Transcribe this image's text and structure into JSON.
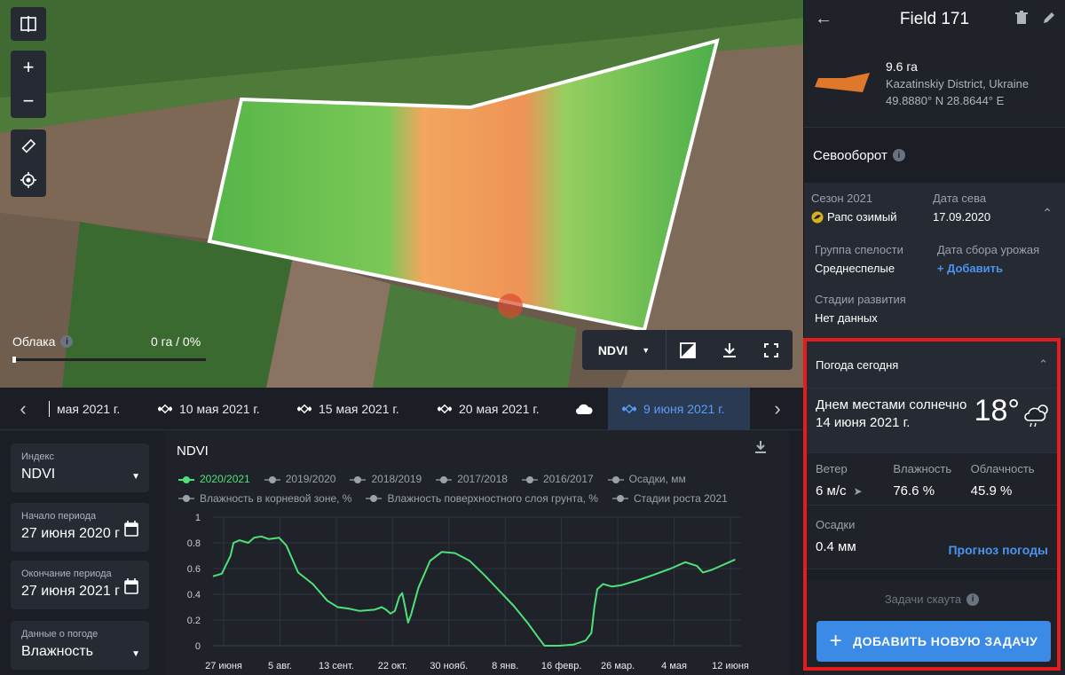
{
  "map": {
    "clouds_label": "Облака",
    "clouds_value": "0 га / 0%",
    "index_label": "NDVI",
    "clouds_slider_fraction": 0.0
  },
  "dates": {
    "items": [
      "мая 2021 г.",
      "10 мая 2021 г.",
      "15 мая 2021 г.",
      "20 мая 2021 г.",
      "",
      "9 июня 2021 г."
    ],
    "active_index": 5
  },
  "filters": {
    "index": {
      "label": "Индекс",
      "value": "NDVI"
    },
    "start": {
      "label": "Начало периода",
      "value": "27 июня 2020 г"
    },
    "end": {
      "label": "Окончание периода",
      "value": "27 июня 2021 г"
    },
    "weather": {
      "label": "Данные о погоде",
      "value": "Влажность"
    }
  },
  "chart_panel": {
    "title": "NDVI",
    "legend": [
      {
        "label": "2020/2021",
        "active": true
      },
      {
        "label": "2019/2020",
        "active": false
      },
      {
        "label": "2018/2019",
        "active": false
      },
      {
        "label": "2017/2018",
        "active": false
      },
      {
        "label": "2016/2017",
        "active": false
      },
      {
        "label": "Осадки, мм",
        "active": false
      },
      {
        "label": "Влажность в корневой зоне, %",
        "active": false
      },
      {
        "label": "Влажность поверхностного слоя грунта, %",
        "active": false
      },
      {
        "label": "Стадии роста 2021",
        "active": false
      }
    ]
  },
  "chart_data": {
    "type": "line",
    "title": "NDVI",
    "xlabel": "",
    "ylabel": "",
    "ylim": [
      0,
      1
    ],
    "yticks": [
      "1",
      "0.8",
      "0.6",
      "0.4",
      "0.2",
      "0"
    ],
    "xticks": [
      "27 июня",
      "5 авг.",
      "13 сент.",
      "22 окт.",
      "30 нояб.",
      "8 янв.",
      "16 февр.",
      "26 мар.",
      "4 мая",
      "12 июня"
    ],
    "grid": true,
    "series": [
      {
        "name": "2020/2021",
        "color": "#4fe07a",
        "points": [
          [
            0,
            0.54
          ],
          [
            6,
            0.56
          ],
          [
            12,
            0.7
          ],
          [
            14,
            0.8
          ],
          [
            18,
            0.82
          ],
          [
            24,
            0.8
          ],
          [
            28,
            0.84
          ],
          [
            33,
            0.85
          ],
          [
            38,
            0.83
          ],
          [
            45,
            0.84
          ],
          [
            50,
            0.78
          ],
          [
            58,
            0.57
          ],
          [
            68,
            0.48
          ],
          [
            78,
            0.35
          ],
          [
            85,
            0.3
          ],
          [
            92,
            0.29
          ],
          [
            100,
            0.27
          ],
          [
            110,
            0.28
          ],
          [
            115,
            0.3
          ],
          [
            118,
            0.28
          ],
          [
            121,
            0.25
          ],
          [
            124,
            0.27
          ],
          [
            127,
            0.38
          ],
          [
            129,
            0.41
          ],
          [
            131,
            0.3
          ],
          [
            133,
            0.18
          ],
          [
            135,
            0.24
          ],
          [
            140,
            0.45
          ],
          [
            148,
            0.66
          ],
          [
            156,
            0.73
          ],
          [
            165,
            0.72
          ],
          [
            175,
            0.66
          ],
          [
            185,
            0.55
          ],
          [
            195,
            0.43
          ],
          [
            205,
            0.31
          ],
          [
            215,
            0.17
          ],
          [
            222,
            0.06
          ],
          [
            226,
            0.0
          ],
          [
            236,
            0.0
          ],
          [
            246,
            0.01
          ],
          [
            254,
            0.04
          ],
          [
            258,
            0.1
          ],
          [
            260,
            0.3
          ],
          [
            262,
            0.44
          ],
          [
            266,
            0.48
          ],
          [
            272,
            0.46
          ],
          [
            278,
            0.47
          ],
          [
            290,
            0.51
          ],
          [
            300,
            0.55
          ],
          [
            312,
            0.6
          ],
          [
            322,
            0.65
          ],
          [
            330,
            0.62
          ],
          [
            334,
            0.57
          ],
          [
            340,
            0.59
          ],
          [
            350,
            0.64
          ],
          [
            356,
            0.67
          ]
        ]
      }
    ]
  },
  "side": {
    "title": "Field 171",
    "area": "9.6 га",
    "location": "Kazatinskiy District, Ukraine",
    "coords": "49.8880° N 28.8644° E",
    "rotation_title": "Севооборот",
    "season_label": "Сезон 2021",
    "crop": "Рапс озимый",
    "sowing_label": "Дата сева",
    "sowing_date": "17.09.2020",
    "maturity_label": "Группа спелости",
    "maturity_value": "Среднеспелые",
    "harvest_label": "Дата сбора урожая",
    "harvest_link": "+ Добавить",
    "stages_label": "Стадии развития",
    "stages_value": "Нет данных"
  },
  "weather": {
    "title": "Погода сегодня",
    "description": "Днем местами солнечно",
    "date": "14 июня 2021 г.",
    "temperature": "18°",
    "wind_label": "Ветер",
    "wind_value": "6 м/с",
    "humidity_label": "Влажность",
    "humidity_value": "76.6 %",
    "cloud_label": "Облачность",
    "cloud_value": "45.9 %",
    "precip_label": "Осадки",
    "precip_value": "0.4 мм",
    "forecast_link": "Прогноз погоды",
    "tasks_label": "Задачи скаута",
    "add_task_label": "ДОБАВИТЬ НОВУЮ ЗАДАЧУ"
  }
}
